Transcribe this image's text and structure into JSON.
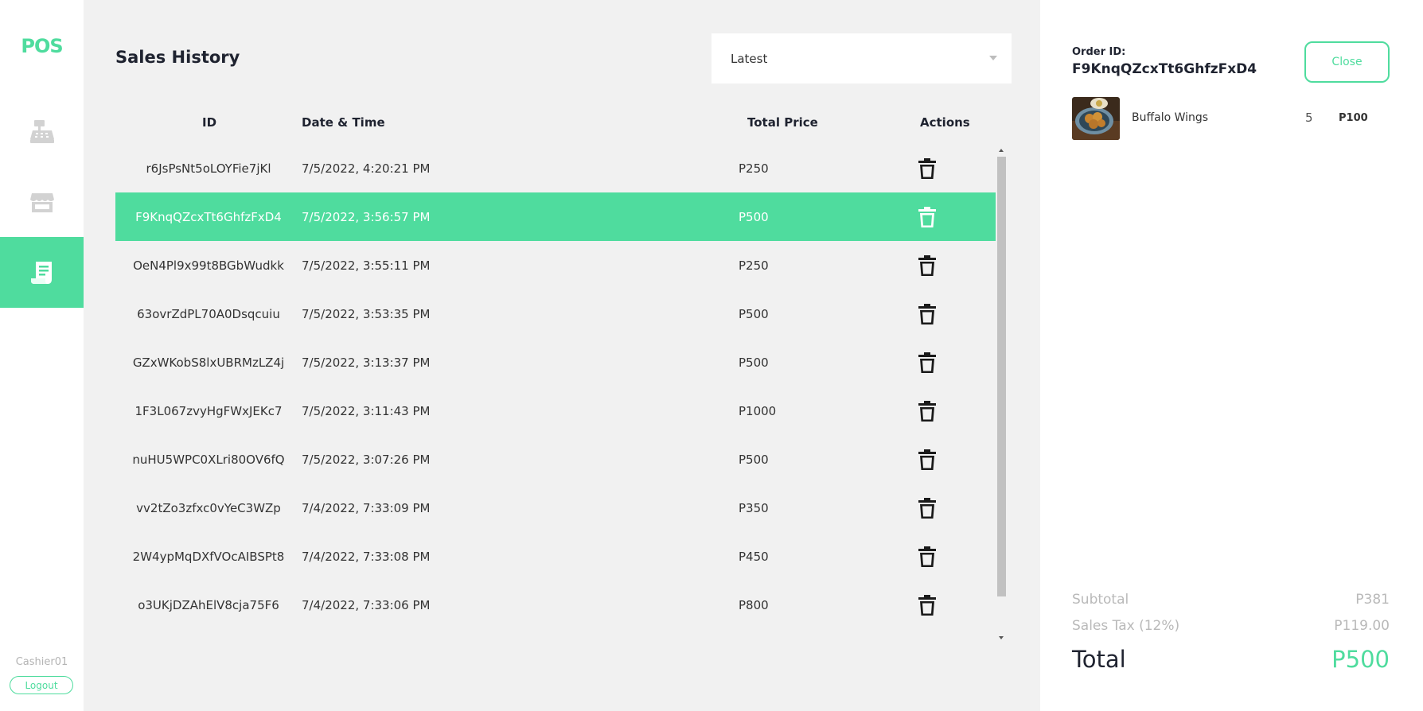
{
  "app": {
    "logo": "POS"
  },
  "sidebar": {
    "nav": [
      {
        "name": "cash-register",
        "icon": "cash-register-icon",
        "active": false
      },
      {
        "name": "store",
        "icon": "store-icon",
        "active": false
      },
      {
        "name": "receipt",
        "icon": "receipt-icon",
        "active": true
      }
    ],
    "user": "Cashier01",
    "logout_label": "Logout"
  },
  "main": {
    "title": "Sales History",
    "sort": {
      "selected": "Latest"
    },
    "columns": {
      "id": "ID",
      "datetime": "Date & Time",
      "total": "Total Price",
      "actions": "Actions"
    },
    "rows": [
      {
        "id": "r6JsPsNt5oLOYFie7jKl",
        "datetime": "7/5/2022, 4:20:21 PM",
        "total": "P250",
        "selected": false
      },
      {
        "id": "F9KnqQZcxTt6GhfzFxD4",
        "datetime": "7/5/2022, 3:56:57 PM",
        "total": "P500",
        "selected": true
      },
      {
        "id": "OeN4Pl9x99t8BGbWudkk",
        "datetime": "7/5/2022, 3:55:11 PM",
        "total": "P250",
        "selected": false
      },
      {
        "id": "63ovrZdPL70A0Dsqcuiu",
        "datetime": "7/5/2022, 3:53:35 PM",
        "total": "P500",
        "selected": false
      },
      {
        "id": "GZxWKobS8lxUBRMzLZ4j",
        "datetime": "7/5/2022, 3:13:37 PM",
        "total": "P500",
        "selected": false
      },
      {
        "id": "1F3L067zvyHgFWxJEKc7",
        "datetime": "7/5/2022, 3:11:43 PM",
        "total": "P1000",
        "selected": false
      },
      {
        "id": "nuHU5WPC0XLri80OV6fQ",
        "datetime": "7/5/2022, 3:07:26 PM",
        "total": "P500",
        "selected": false
      },
      {
        "id": "vv2tZo3zfxc0vYeC3WZp",
        "datetime": "7/4/2022, 7:33:09 PM",
        "total": "P350",
        "selected": false
      },
      {
        "id": "2W4ypMqDXfVOcAIBSPt8",
        "datetime": "7/4/2022, 7:33:08 PM",
        "total": "P450",
        "selected": false
      },
      {
        "id": "o3UKjDZAhElV8cja75F6",
        "datetime": "7/4/2022, 7:33:06 PM",
        "total": "P800",
        "selected": false
      }
    ]
  },
  "order": {
    "label": "Order ID:",
    "id": "F9KnqQZcxTt6GhfzFxD4",
    "close_label": "Close",
    "items": [
      {
        "name": "Buffalo Wings",
        "qty": "5",
        "price": "P100"
      }
    ],
    "subtotal_label": "Subtotal",
    "subtotal": "P381",
    "tax_label": "Sales Tax (12%)",
    "tax": "P119.00",
    "total_label": "Total",
    "total": "P500"
  },
  "colors": {
    "accent": "#4fdc9e",
    "text_dark": "#1f2330",
    "muted": "#b9b9b9",
    "bg": "#f1f1f1"
  }
}
